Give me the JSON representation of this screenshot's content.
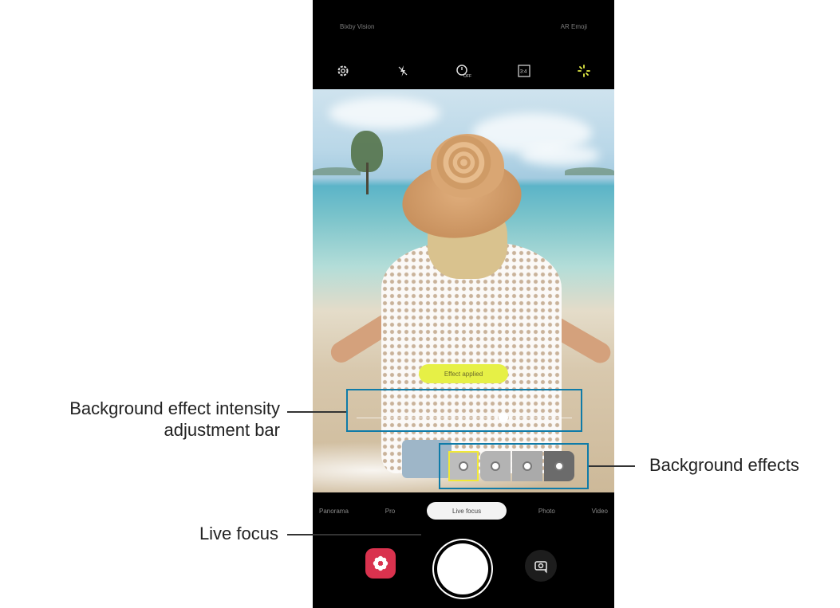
{
  "camera": {
    "top_left_text": "Bixby Vision",
    "top_right_text": "AR Emoji",
    "aspect_ratio": "3:4",
    "timer_label": "OFF",
    "effect_applied": "Effect applied",
    "intensity_level": 0.68,
    "selected_effect_index": 0,
    "modes": [
      "Panorama",
      "Pro",
      "Live focus",
      "Photo",
      "Video"
    ],
    "active_mode": "Live focus"
  },
  "callouts": {
    "intensity_bar_line1": "Background effect intensity",
    "intensity_bar_line2": "adjustment bar",
    "background_effects": "Background effects",
    "live_focus": "Live focus"
  },
  "colors": {
    "callout_box": "#0f7ba8",
    "effect_pill": "#e6f046",
    "gallery_button": "#d9324e"
  },
  "icons": [
    "settings-icon",
    "flash-off-icon",
    "timer-icon",
    "aspect-ratio-icon",
    "filter-icon",
    "gallery-icon",
    "switch-camera-icon"
  ]
}
